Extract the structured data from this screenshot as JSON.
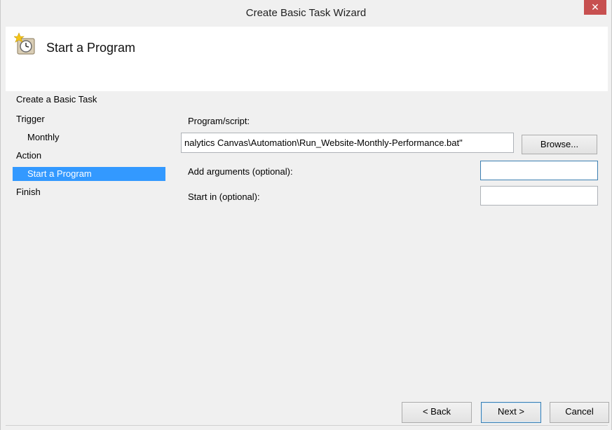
{
  "window": {
    "title": "Create Basic Task Wizard",
    "close_glyph": "✕"
  },
  "header": {
    "title": "Start a Program",
    "icon": "task-scheduler-clock-icon"
  },
  "steps": [
    {
      "label": "Create a Basic Task"
    },
    {
      "label": "Trigger"
    },
    {
      "label": "Monthly"
    },
    {
      "label": "Action"
    },
    {
      "label": "Start a Program"
    },
    {
      "label": "Finish"
    }
  ],
  "form": {
    "program_label": "Program/script:",
    "program_value": "nalytics Canvas\\Automation\\Run_Website-Monthly-Performance.bat\"",
    "browse_label": "Browse...",
    "args_label": "Add arguments (optional):",
    "args_value": "",
    "start_in_label": "Start in (optional):",
    "start_in_value": ""
  },
  "buttons": {
    "back": "< Back",
    "next": "Next >",
    "cancel": "Cancel"
  },
  "colors": {
    "selection": "#3399ff",
    "close": "#c75050",
    "focus_border": "#3c7fb1"
  }
}
